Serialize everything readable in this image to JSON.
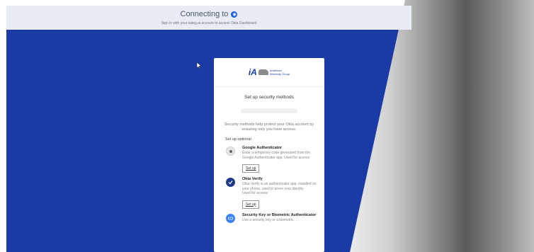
{
  "header": {
    "title": "Connecting to",
    "subtitle": "Sign in with your saleg.ai account to access Okta Dashboard"
  },
  "card": {
    "logo_mark": "iA",
    "logo_text_line1": "American",
    "logo_text_line2": "Warranty Group",
    "title": "Set up security methods",
    "description": "Security methods help protect your Okta account by ensuring only you have access.",
    "setup_optional_label": "Set up optional",
    "methods": [
      {
        "name": "Google Authenticator",
        "description": "Enter a temporary code generated from the Google Authenticator app. Used for access",
        "button": "Set up",
        "icon": "google-authenticator-icon"
      },
      {
        "name": "Okta Verify",
        "description": "Okta Verify is an authenticator app, installed on your phone, used to prove your identity",
        "usage": "Used for access",
        "button": "Set up",
        "icon": "okta-verify-icon"
      },
      {
        "name": "Security Key or Biometric Authenticator",
        "description": "Use a security key or a biometric",
        "icon": "security-key-icon"
      }
    ]
  },
  "colors": {
    "background_blue": "#1a3aa6",
    "header_bg": "#e9ecf5",
    "okta_blue": "#1a60d6"
  }
}
